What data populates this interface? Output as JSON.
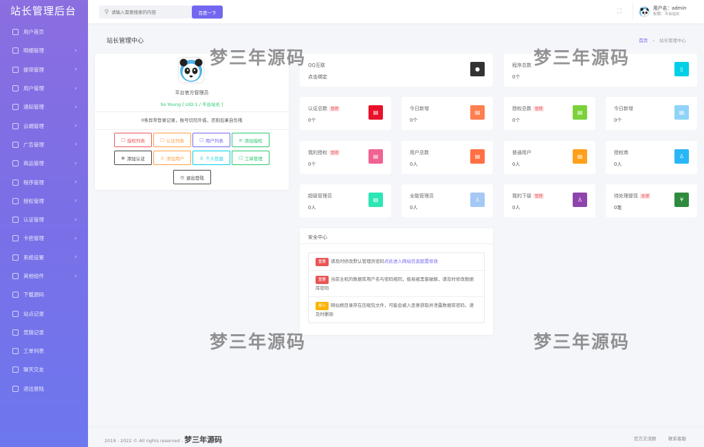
{
  "sidebar": {
    "title": "站长管理后台",
    "items": [
      {
        "label": "用户首页",
        "arrow": ""
      },
      {
        "label": "明细管理",
        "arrow": "›"
      },
      {
        "label": "提现管理",
        "arrow": "›"
      },
      {
        "label": "用户管理",
        "arrow": "›"
      },
      {
        "label": "通知管理",
        "arrow": "›"
      },
      {
        "label": "云端管理",
        "arrow": "›"
      },
      {
        "label": "广告管理",
        "arrow": "›"
      },
      {
        "label": "商品管理",
        "arrow": "›"
      },
      {
        "label": "程序管理",
        "arrow": "›"
      },
      {
        "label": "授权管理",
        "arrow": "›"
      },
      {
        "label": "认证管理",
        "arrow": "›"
      },
      {
        "label": "卡密管理",
        "arrow": "›"
      },
      {
        "label": "系统设置",
        "arrow": "›"
      },
      {
        "label": "其他组件",
        "arrow": "›"
      },
      {
        "label": "下载源码",
        "arrow": ""
      },
      {
        "label": "站点记录",
        "arrow": ""
      },
      {
        "label": "竞猜记录",
        "arrow": ""
      },
      {
        "label": "工单列表",
        "arrow": ""
      },
      {
        "label": "聊天交友",
        "arrow": ""
      },
      {
        "label": "退出登陆",
        "arrow": ""
      }
    ]
  },
  "topbar": {
    "search_placeholder": "请输入需要搜索的内容",
    "search_button": "百度一下",
    "fullscreen_icon": "⛶",
    "user_name": "用户名：admin",
    "user_role": "权限：平台站长"
  },
  "page": {
    "title": "站长管理中心",
    "breadcrumb_home": "首页",
    "breadcrumb_sep": "›",
    "breadcrumb_current": "站长管理中心"
  },
  "profile": {
    "name": "平台官方管理员",
    "sub": "So Young [ UID:1 / 平台站长 ]",
    "note": "0条异常登录记录，账号切勿外借，否则后果自负哦",
    "buttons": [
      {
        "label": "授权列表",
        "icon": "☐",
        "color": "#ea5455"
      },
      {
        "label": "认证列表",
        "icon": "☐",
        "color": "#ff9f43"
      },
      {
        "label": "用户列表",
        "icon": "☐",
        "color": "#7367f0"
      },
      {
        "label": "添加授权",
        "icon": "⊘",
        "color": "#28c76f"
      },
      {
        "label": "添加认证",
        "icon": "⊕",
        "color": "#444444"
      },
      {
        "label": "添加用户",
        "icon": "♙",
        "color": "#ff9f43"
      },
      {
        "label": "个人信息",
        "icon": "♙",
        "color": "#00cfe8"
      },
      {
        "label": "工单管理",
        "icon": "☐",
        "color": "#28c76f"
      },
      {
        "label": "退出登陆",
        "icon": "◷",
        "color": "#444444"
      }
    ]
  },
  "stats": [
    {
      "title": "QQ互联",
      "value": "点击绑定",
      "tag": "",
      "color": "#333333",
      "icon": "●"
    },
    {
      "title": "程序总数",
      "value": "0个",
      "tag": "",
      "color": "#00cfe8",
      "icon": "▯"
    },
    {
      "title": "认证总数",
      "value": "0个",
      "tag": "管理",
      "color": "#e8112a",
      "icon": "▤"
    },
    {
      "title": "今日新增",
      "value": "0个",
      "tag": "",
      "color": "#ff7f50",
      "icon": "▤"
    },
    {
      "title": "授权总数",
      "value": "0个",
      "tag": "管理",
      "color": "#7bd13a",
      "icon": "▤"
    },
    {
      "title": "今日新增",
      "value": "0个",
      "tag": "",
      "color": "#8fd3f8",
      "icon": "▤"
    },
    {
      "title": "我的授权",
      "value": "0个",
      "tag": "管理",
      "color": "#f06292",
      "icon": "▤"
    },
    {
      "title": "用户总数",
      "value": "0人",
      "tag": "",
      "color": "#ff7043",
      "icon": "▤"
    },
    {
      "title": "普通用户",
      "value": "0人",
      "tag": "",
      "color": "#ff9f1a",
      "icon": "▤"
    },
    {
      "title": "授权商",
      "value": "0人",
      "tag": "",
      "color": "#29b6f6",
      "icon": "♙"
    },
    {
      "title": "超级管理员",
      "value": "0人",
      "tag": "",
      "color": "#2ce6b5",
      "icon": "▤"
    },
    {
      "title": "全能管理员",
      "value": "0人",
      "tag": "",
      "color": "#a5c8f5",
      "icon": "♙"
    },
    {
      "title": "我的下级",
      "value": "0人",
      "tag": "管理",
      "color": "#8e44ad",
      "icon": "♙"
    },
    {
      "title": "待处理提现",
      "value": "0笔",
      "tag": "处理",
      "color": "#2e8b3e",
      "icon": "¥"
    }
  ],
  "security": {
    "title": "安全中心",
    "rows": [
      {
        "badge": "重要",
        "badge_color": "#ea5455",
        "text": "请及时修改默认管理员密码",
        "link": "点此进入网站信息配置修改"
      },
      {
        "badge": "重要",
        "badge_color": "#ea5455",
        "text": "当前主机的数据库用户名与密码相同，极易被黑客破解，请及时修改数据库密码",
        "link": ""
      },
      {
        "badge": "提示",
        "badge_color": "#ffb300",
        "text": "网站根目录存在压缩包文件，可能会被入恶意获取并泄露数据库密码，请及时删除",
        "link": ""
      }
    ]
  },
  "watermark": "梦三年源码",
  "footer": {
    "copyright": "2019 - 2022 © All rights reserved - ",
    "brand": "梦三年源码",
    "link1": "官方交流群",
    "link2": "联系客服"
  }
}
